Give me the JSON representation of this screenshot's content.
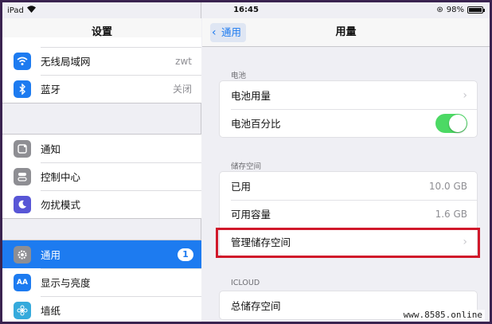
{
  "status_bar": {
    "device": "iPad",
    "time": "16:45",
    "battery": "98%"
  },
  "left_nav": {
    "title": "设置"
  },
  "sidebar": {
    "group1": [
      {
        "label": "无线局域网",
        "value": "zwt",
        "icon": "wifi-icon",
        "color": "#1d7bf0"
      },
      {
        "label": "蓝牙",
        "value": "关闭",
        "icon": "bluetooth-icon",
        "color": "#1d7bf0"
      }
    ],
    "group2": [
      {
        "label": "通知",
        "icon": "notification-icon",
        "color": "#8e8e93"
      },
      {
        "label": "控制中心",
        "icon": "control-center-icon",
        "color": "#8e8e93"
      },
      {
        "label": "勿扰模式",
        "icon": "moon-icon",
        "color": "#5856d6"
      }
    ],
    "group3": [
      {
        "label": "通用",
        "badge": "1",
        "icon": "gear-icon",
        "color": "#8e8e93",
        "selected": true
      },
      {
        "label": "显示与亮度",
        "icon": "display-icon",
        "color": "#1d7bf0"
      },
      {
        "label": "墙纸",
        "icon": "wallpaper-icon",
        "color": "#35aadc"
      }
    ]
  },
  "right_nav": {
    "back_label": "通用",
    "title": "用量"
  },
  "battery_section": {
    "header": "电池",
    "rows": [
      {
        "label": "电池用量"
      },
      {
        "label": "电池百分比",
        "toggle": "on"
      }
    ]
  },
  "storage_section": {
    "header": "储存空间",
    "rows": [
      {
        "label": "已用",
        "value": "10.0 GB"
      },
      {
        "label": "可用容量",
        "value": "1.6 GB"
      },
      {
        "label": "管理储存空间"
      }
    ]
  },
  "icloud_section": {
    "header": "ICLOUD",
    "rows": [
      {
        "label": "总储存空间"
      }
    ]
  },
  "watermark": "www.8585.online",
  "colors": {
    "accent": "#1d7bf0",
    "toggle_on": "#4cd964",
    "highlight": "#d0182a"
  }
}
